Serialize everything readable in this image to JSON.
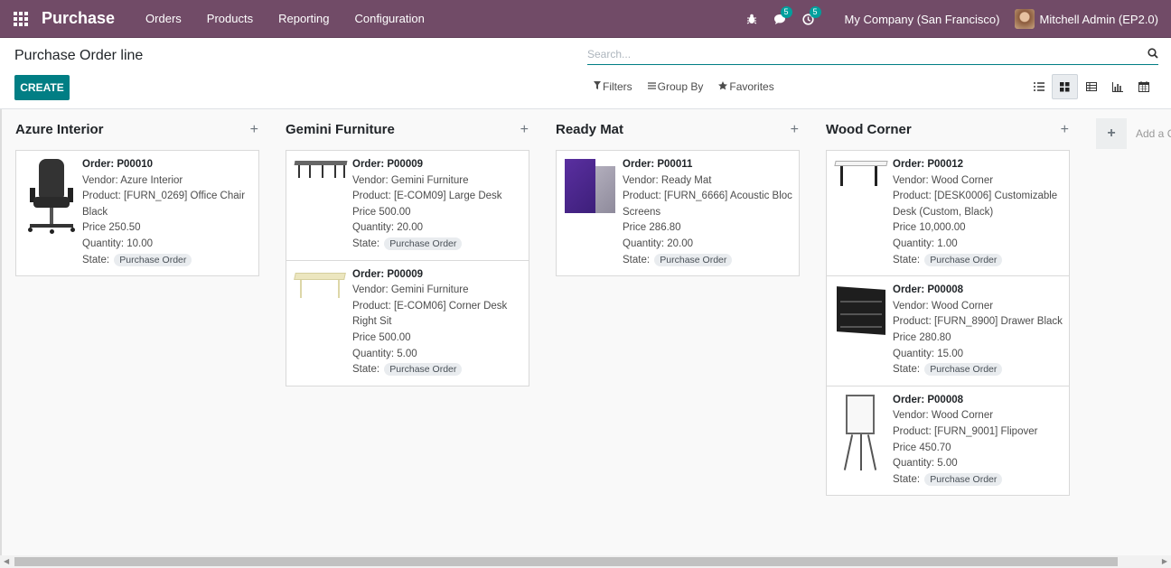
{
  "navbar": {
    "app_name": "Purchase",
    "menu": [
      "Orders",
      "Products",
      "Reporting",
      "Configuration"
    ],
    "messages_count": "5",
    "activities_count": "5",
    "company": "My Company (San Francisco)",
    "user": "Mitchell Admin (EP2.0)"
  },
  "control": {
    "breadcrumb": "Purchase Order line",
    "create_label": "CREATE",
    "search_placeholder": "Search...",
    "filters_label": "Filters",
    "groupby_label": "Group By",
    "favorites_label": "Favorites"
  },
  "labels": {
    "order": "Order:",
    "vendor": "Vendor:",
    "product": "Product:",
    "price": "Price",
    "quantity": "Quantity:",
    "state": "State:"
  },
  "columns": [
    {
      "title": "Azure Interior",
      "cards": [
        {
          "order": "P00010",
          "vendor": "Azure Interior",
          "product": "[FURN_0269] Office Chair Black",
          "price": "250.50",
          "quantity": "10.00",
          "state": "Purchase Order",
          "image": "office-chair"
        }
      ]
    },
    {
      "title": "Gemini Furniture",
      "cards": [
        {
          "order": "P00009",
          "vendor": "Gemini Furniture",
          "product": "[E-COM09] Large Desk",
          "price": "500.00",
          "quantity": "20.00",
          "state": "Purchase Order",
          "image": "large-desk"
        },
        {
          "order": "P00009",
          "vendor": "Gemini Furniture",
          "product": "[E-COM06] Corner Desk Right Sit",
          "price": "500.00",
          "quantity": "5.00",
          "state": "Purchase Order",
          "image": "corner-desk"
        }
      ]
    },
    {
      "title": "Ready Mat",
      "cards": [
        {
          "order": "P00011",
          "vendor": "Ready Mat",
          "product": "[FURN_6666] Acoustic Bloc Screens",
          "price": "286.80",
          "quantity": "20.00",
          "state": "Purchase Order",
          "image": "acoustic-screens"
        }
      ]
    },
    {
      "title": "Wood Corner",
      "cards": [
        {
          "order": "P00012",
          "vendor": "Wood Corner",
          "product": "[DESK0006] Customizable Desk (Custom, Black)",
          "price": "10,000.00",
          "quantity": "1.00",
          "state": "Purchase Order",
          "image": "customizable-desk"
        },
        {
          "order": "P00008",
          "vendor": "Wood Corner",
          "product": "[FURN_8900] Drawer Black",
          "price": "280.80",
          "quantity": "15.00",
          "state": "Purchase Order",
          "image": "drawer-black"
        },
        {
          "order": "P00008",
          "vendor": "Wood Corner",
          "product": "[FURN_9001] Flipover",
          "price": "450.70",
          "quantity": "5.00",
          "state": "Purchase Order",
          "image": "flipover"
        }
      ]
    }
  ],
  "add_column_label": "Add a Column"
}
